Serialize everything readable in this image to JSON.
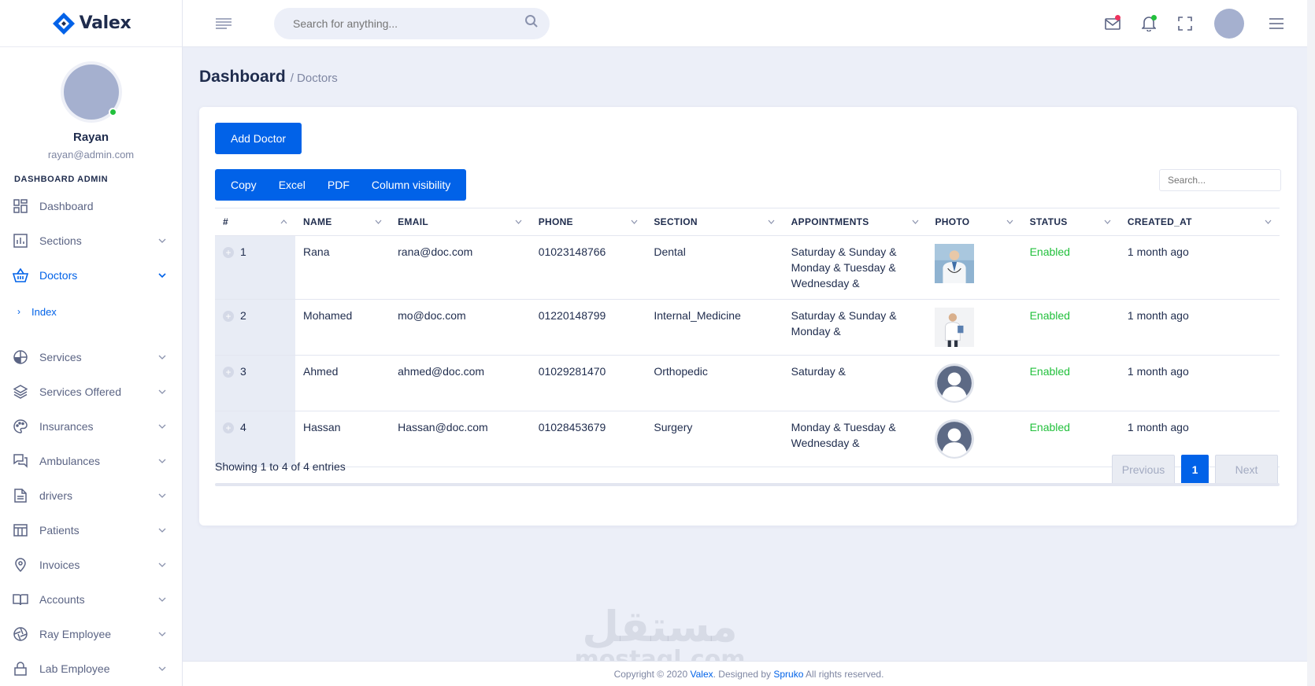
{
  "brand": {
    "name": "Valex",
    "color": "#0162e8"
  },
  "colors": {
    "primary": "#0162e8",
    "success": "#22c03c",
    "danger": "#ee335e"
  },
  "sidebar": {
    "user": {
      "name": "Rayan",
      "email": "rayan@admin.com",
      "online": true
    },
    "section_label": "DASHBOARD ADMIN",
    "items": [
      {
        "label": "Dashboard",
        "icon": "grid-icon"
      },
      {
        "label": "Sections",
        "icon": "bar-chart-icon"
      },
      {
        "label": "Doctors",
        "icon": "basket-icon"
      },
      {
        "label": "Services",
        "icon": "pie-chart-icon"
      },
      {
        "label": "Services Offered",
        "icon": "layers-icon"
      },
      {
        "label": "Insurances",
        "icon": "palette-icon"
      },
      {
        "label": "Ambulances",
        "icon": "chat-icon"
      },
      {
        "label": "drivers",
        "icon": "document-icon"
      },
      {
        "label": "Patients",
        "icon": "table-icon"
      },
      {
        "label": "Invoices",
        "icon": "location-pin-icon"
      },
      {
        "label": "Accounts",
        "icon": "book-icon"
      },
      {
        "label": "Ray Employee",
        "icon": "aperture-icon"
      },
      {
        "label": "Lab Employee",
        "icon": "lock-icon"
      }
    ],
    "sub_item": "Index"
  },
  "topbar": {
    "search_placeholder": "Search for anything..."
  },
  "breadcrumb": {
    "title": "Dashboard",
    "current": "/ Doctors"
  },
  "actions": {
    "add_doctor": "Add Doctor"
  },
  "export": {
    "copy": "Copy",
    "excel": "Excel",
    "pdf": "PDF",
    "column_visibility": "Column visibility"
  },
  "table_search_placeholder": "Search...",
  "table": {
    "headers": [
      "#",
      "NAME",
      "EMAIL",
      "PHONE",
      "SECTION",
      "APPOINTMENTS",
      "PHOTO",
      "STATUS",
      "CREATED_AT"
    ],
    "rows": [
      {
        "id": "1",
        "name": "Rana",
        "email": "rana@doc.com",
        "phone": "01023148766",
        "section": "Dental",
        "appointments": "Saturday & Sunday & Monday & Tuesday & Wednesday &",
        "photo": "doctor-photo",
        "status": "Enabled",
        "created": "1 month ago"
      },
      {
        "id": "2",
        "name": "Mohamed",
        "email": "mo@doc.com",
        "phone": "01220148799",
        "section": "Internal_Medicine",
        "appointments": "Saturday & Sunday & Monday &",
        "photo": "doctor-photo",
        "status": "Enabled",
        "created": "1 month ago"
      },
      {
        "id": "3",
        "name": "Ahmed",
        "email": "ahmed@doc.com",
        "phone": "01029281470",
        "section": "Orthopedic",
        "appointments": "Saturday &",
        "photo": "avatar-placeholder",
        "status": "Enabled",
        "created": "1 month ago"
      },
      {
        "id": "4",
        "name": "Hassan",
        "email": "Hassan@doc.com",
        "phone": "01028453679",
        "section": "Surgery",
        "appointments": "Monday & Tuesday & Wednesday &",
        "photo": "avatar-placeholder",
        "status": "Enabled",
        "created": "1 month ago"
      }
    ]
  },
  "showing": "Showing 1 to 4 of 4 entries",
  "pagination": {
    "previous": "Previous",
    "current": "1",
    "next": "Next"
  },
  "watermark": {
    "arabic": "مستقل",
    "latin": "mostaql.com"
  },
  "footer": {
    "prefix": "Copyright © 2020 ",
    "brand": "Valex",
    "middle": ". Designed by ",
    "designer": "Spruko",
    "suffix": " All rights reserved."
  }
}
